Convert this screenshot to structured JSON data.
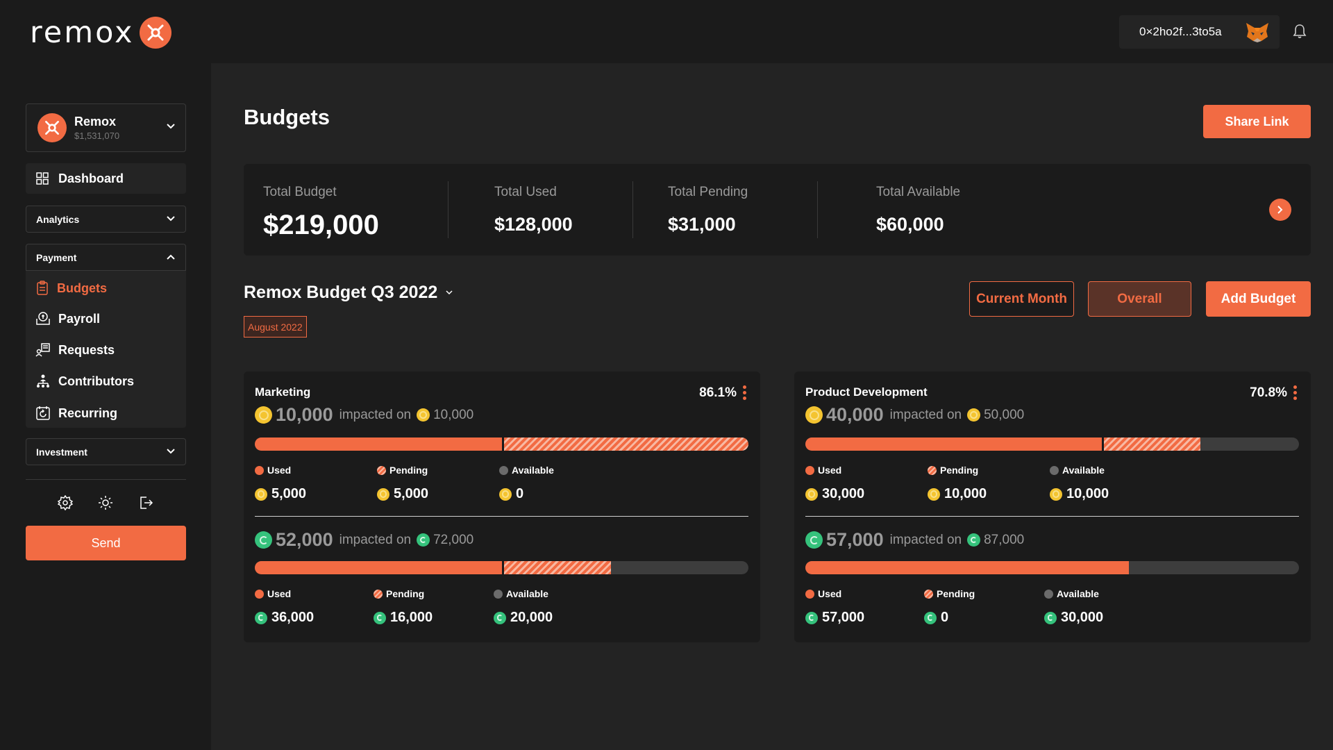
{
  "app": {
    "logo_text": "remox",
    "wallet_address": "0×2ho2f...3to5a"
  },
  "sidebar": {
    "org_name": "Remox",
    "org_balance": "$1,531,070",
    "dashboard": "Dashboard",
    "analytics": "Analytics",
    "payment": "Payment",
    "submenu": [
      {
        "label": "Budgets",
        "icon": "budgets-icon",
        "active": true
      },
      {
        "label": "Payroll",
        "icon": "payroll-icon",
        "active": false
      },
      {
        "label": "Requests",
        "icon": "requests-icon",
        "active": false
      },
      {
        "label": "Contributors",
        "icon": "contributors-icon",
        "active": false
      },
      {
        "label": "Recurring",
        "icon": "recurring-icon",
        "active": false
      }
    ],
    "investment": "Investment",
    "send": "Send"
  },
  "page": {
    "title": "Budgets",
    "share_link": "Share Link"
  },
  "totals": [
    {
      "label": "Total Budget",
      "value": "$219,000"
    },
    {
      "label": "Total Used",
      "value": "$128,000"
    },
    {
      "label": "Total Pending",
      "value": "$31,000"
    },
    {
      "label": "Total Available",
      "value": "$60,000"
    }
  ],
  "budget": {
    "title": "Remox Budget Q3 2022",
    "month": "August 2022",
    "current_month": "Current Month",
    "overall": "Overall",
    "add_budget": "Add Budget"
  },
  "labels": {
    "impacted_on": "impacted on",
    "used": "Used",
    "pending": "Pending",
    "available": "Available"
  },
  "colors": {
    "accent": "#f26b43",
    "background": "#1b1b1b",
    "panel": "#232323",
    "gold_coin": "#f4c430",
    "green_coin": "#35c27c"
  },
  "cards": [
    {
      "name": "Marketing",
      "percent": "86.1%",
      "rows": [
        {
          "coin": "gold",
          "amount": "10,000",
          "impacted": "10,000",
          "used_frac": 0.5,
          "pending_frac": 0.5,
          "used": "5,000",
          "pending": "5,000",
          "available": "0"
        },
        {
          "coin": "green",
          "amount": "52,000",
          "impacted": "72,000",
          "used_frac": 0.5,
          "pending_frac": 0.222,
          "used": "36,000",
          "pending": "16,000",
          "available": "20,000"
        }
      ]
    },
    {
      "name": "Product Development",
      "percent": "70.8%",
      "rows": [
        {
          "coin": "gold",
          "amount": "40,000",
          "impacted": "50,000",
          "used_frac": 0.6,
          "pending_frac": 0.2,
          "used": "30,000",
          "pending": "10,000",
          "available": "10,000"
        },
        {
          "coin": "green",
          "amount": "57,000",
          "impacted": "87,000",
          "used_frac": 0.655,
          "pending_frac": 0,
          "used": "57,000",
          "pending": "0",
          "available": "30,000"
        }
      ]
    }
  ]
}
